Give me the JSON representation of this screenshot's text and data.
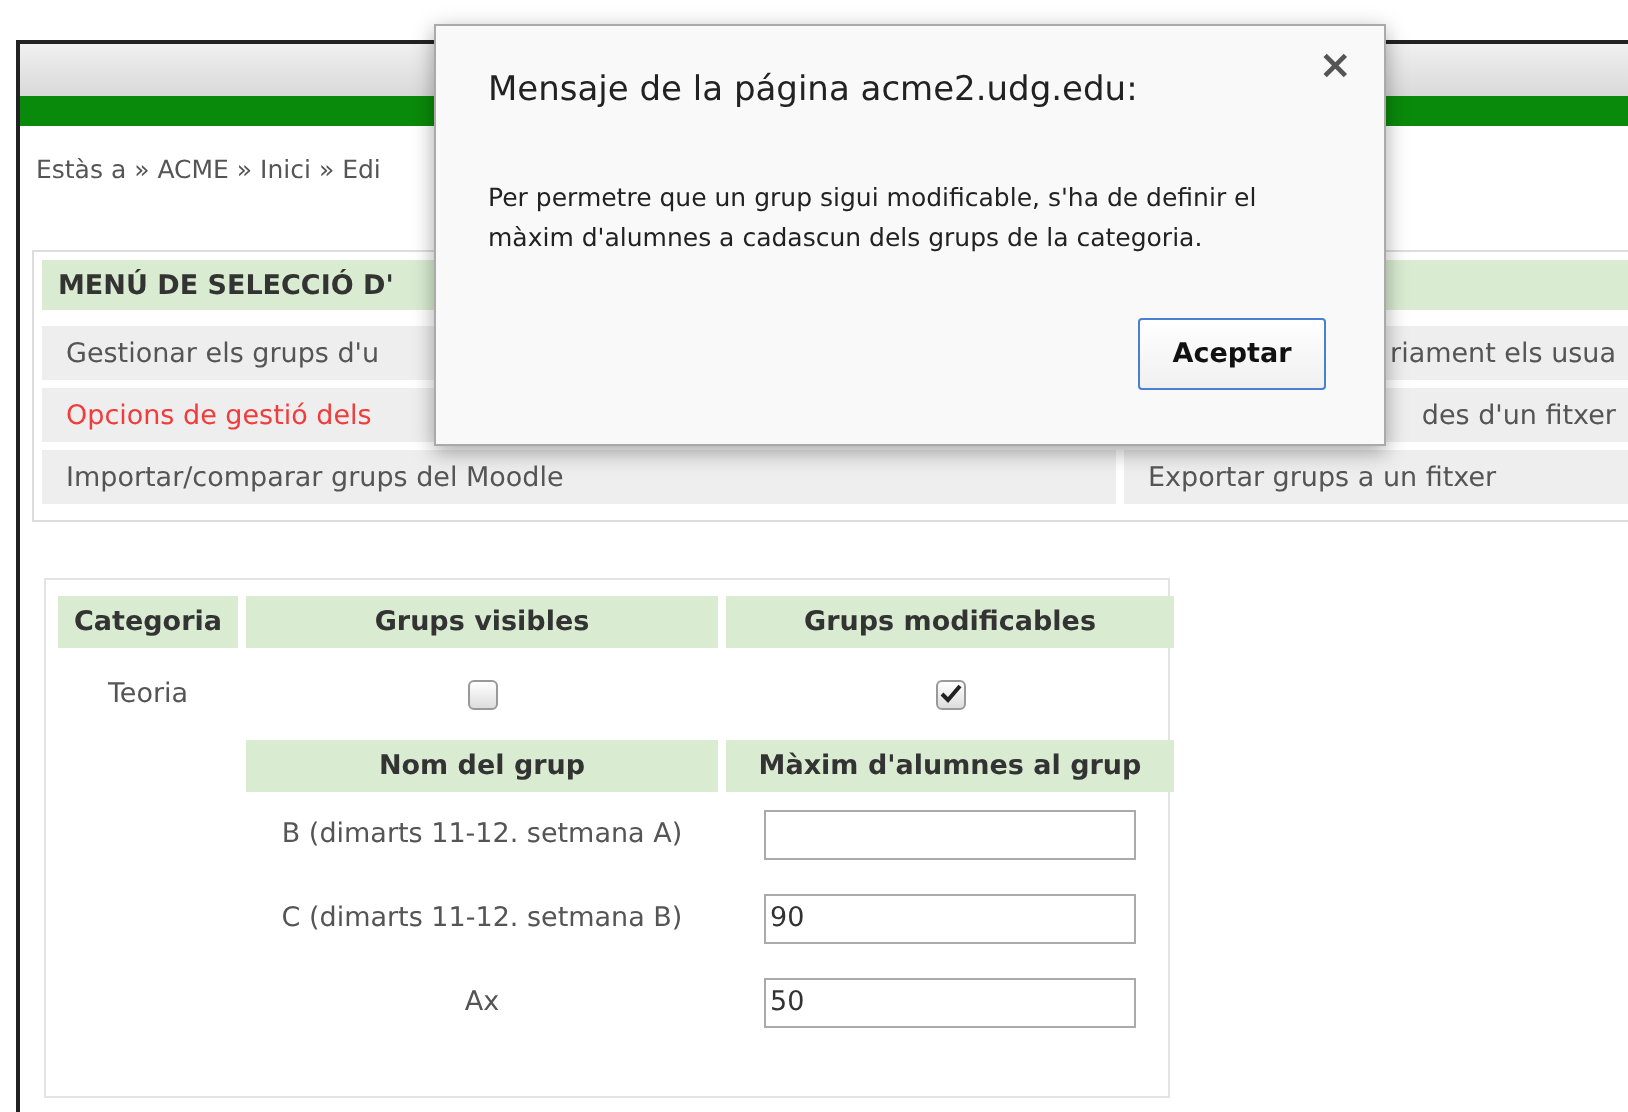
{
  "breadcrumb": "Estàs a » ACME » Inici » Edi",
  "menu": {
    "title": "MENÚ DE SELECCIÓ D'",
    "rows": [
      [
        {
          "label": "Gestionar els grups d'u",
          "selected": false,
          "covered": false
        },
        {
          "label": "riament els usua",
          "selected": false,
          "covered": true
        }
      ],
      [
        {
          "label": "Opcions de gestió dels",
          "selected": true,
          "covered": false
        },
        {
          "label": "des d'un fitxer",
          "selected": false,
          "covered": true
        }
      ],
      [
        {
          "label": "Importar/comparar grups del Moodle",
          "selected": false,
          "covered": false
        },
        {
          "label": "Exportar grups a un fitxer",
          "selected": false,
          "covered": false
        }
      ]
    ]
  },
  "category_table": {
    "columns": [
      "Categoria",
      "Grups visibles",
      "Grups modificables"
    ],
    "rows": [
      {
        "category": "Teoria",
        "visible": false,
        "modifiable": true
      }
    ]
  },
  "groups_table": {
    "columns": [
      "Nom del grup",
      "Màxim d'alumnes al grup"
    ],
    "rows": [
      {
        "name": "B (dimarts 11-12. setmana A)",
        "max": ""
      },
      {
        "name": "C (dimarts 11-12. setmana B)",
        "max": "90"
      },
      {
        "name": "Ax",
        "max": "50"
      }
    ]
  },
  "dialog": {
    "title": "Mensaje de la página acme2.udg.edu:",
    "close": "×",
    "message": "Per permetre que un grup sigui modificable, s'ha de definir el màxim d'alumnes a cadascun dels grups de la categoria.",
    "button": "Aceptar"
  }
}
